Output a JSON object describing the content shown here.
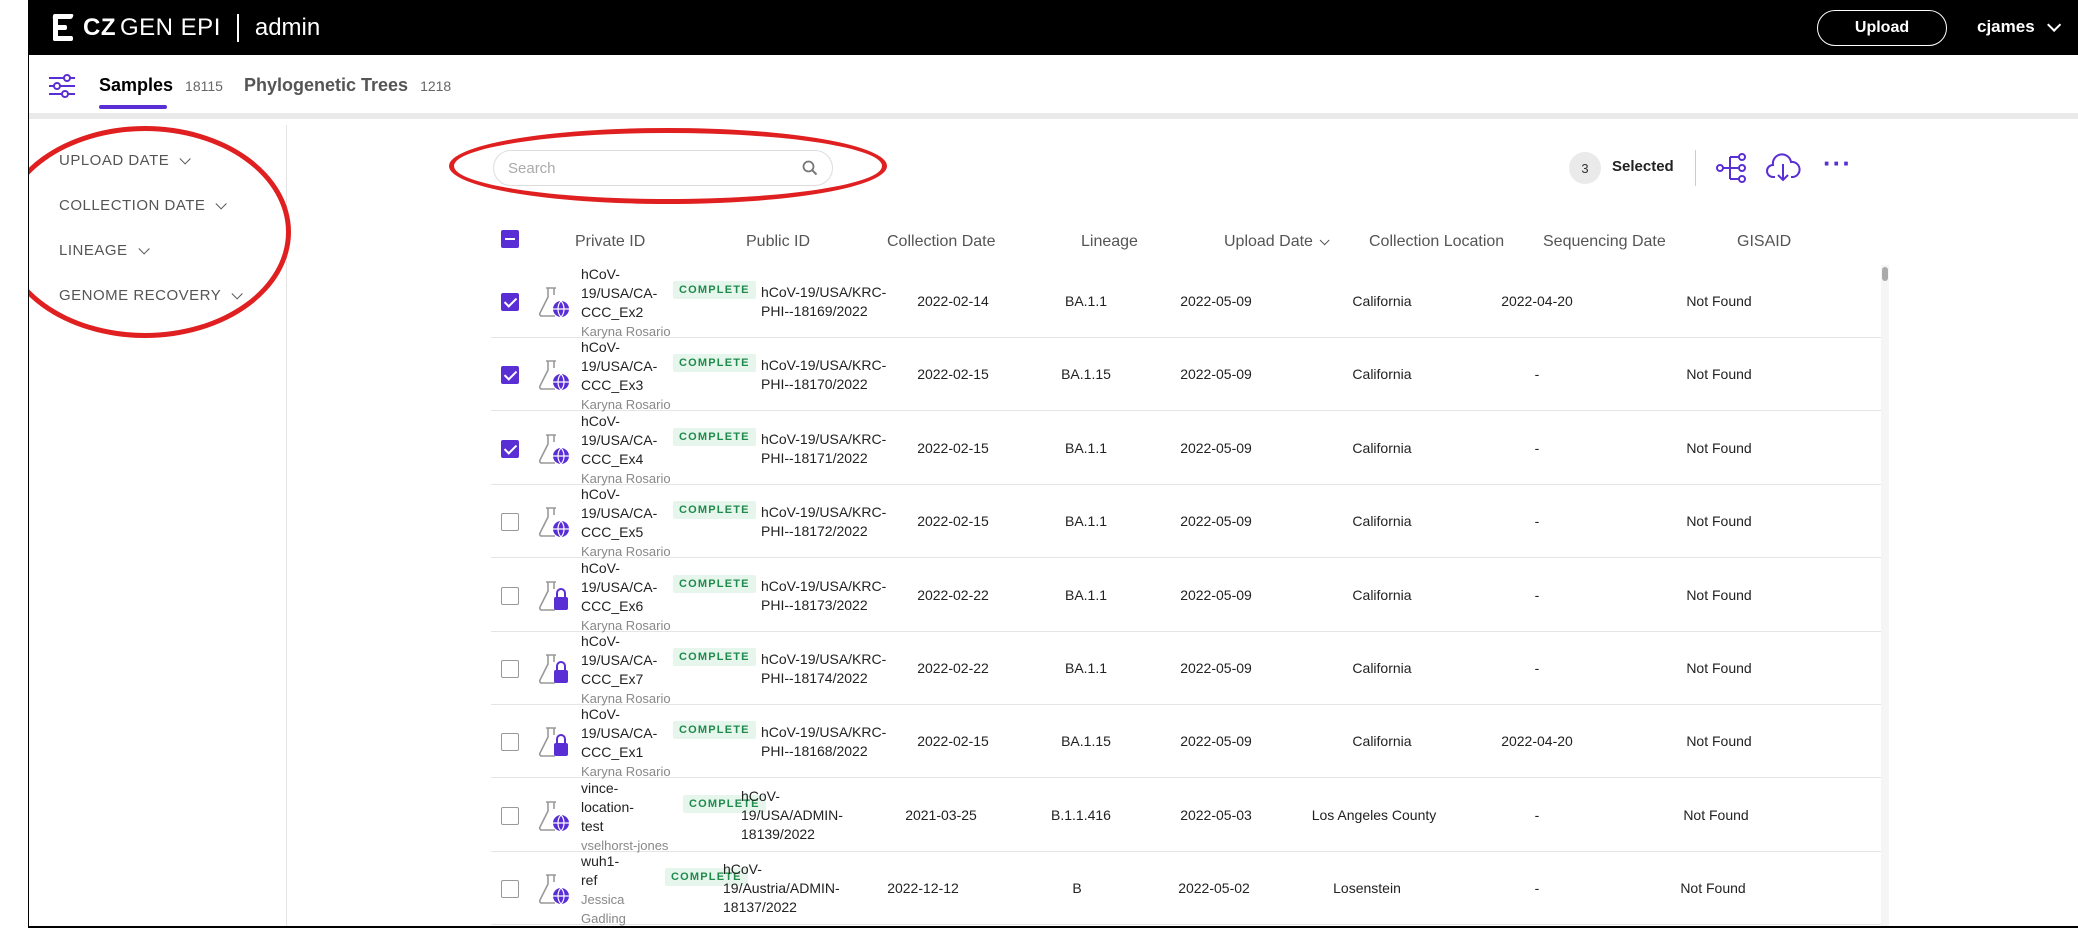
{
  "header": {
    "logo_cz": "CZ",
    "logo_gen_epi": "GEN EPI",
    "admin_label": "admin",
    "upload_label": "Upload",
    "user_name": "cjames"
  },
  "tabs": [
    {
      "label": "Samples",
      "count": "18115",
      "active": true
    },
    {
      "label": "Phylogenetic Trees",
      "count": "1218",
      "active": false
    }
  ],
  "filters": [
    {
      "label": "UPLOAD DATE"
    },
    {
      "label": "COLLECTION DATE"
    },
    {
      "label": "LINEAGE"
    },
    {
      "label": "GENOME RECOVERY"
    }
  ],
  "search": {
    "placeholder": "Search",
    "value": ""
  },
  "toolbar": {
    "selected_count": "3",
    "selected_label": "Selected",
    "tree_icon": "phylo-tree-icon",
    "download_icon": "cloud-download-icon",
    "more_label": "···"
  },
  "table": {
    "columns": [
      "Private ID",
      "Public ID",
      "Collection Date",
      "Lineage",
      "Upload Date",
      "Collection Location",
      "Sequencing Date",
      "GISAID"
    ],
    "sorted_column": "Upload Date",
    "rows": [
      {
        "checked": true,
        "icon": "globe",
        "private_lines": [
          "hCoV-",
          "19/USA/CA-",
          "CCC_Ex2"
        ],
        "uploader": "Karyna Rosario",
        "status": "COMPLETE",
        "public_lines": [
          "hCoV-19/USA/KRC-",
          "PHI--18169/2022"
        ],
        "collection_date": "2022-02-14",
        "lineage": "BA.1.1",
        "upload_date": "2022-05-09",
        "location": "California",
        "sequencing_date": "2022-04-20",
        "gisaid": "Not Found"
      },
      {
        "checked": true,
        "icon": "globe",
        "private_lines": [
          "hCoV-",
          "19/USA/CA-",
          "CCC_Ex3"
        ],
        "uploader": "Karyna Rosario",
        "status": "COMPLETE",
        "public_lines": [
          "hCoV-19/USA/KRC-",
          "PHI--18170/2022"
        ],
        "collection_date": "2022-02-15",
        "lineage": "BA.1.15",
        "upload_date": "2022-05-09",
        "location": "California",
        "sequencing_date": "-",
        "gisaid": "Not Found"
      },
      {
        "checked": true,
        "icon": "globe",
        "private_lines": [
          "hCoV-",
          "19/USA/CA-",
          "CCC_Ex4"
        ],
        "uploader": "Karyna Rosario",
        "status": "COMPLETE",
        "public_lines": [
          "hCoV-19/USA/KRC-",
          "PHI--18171/2022"
        ],
        "collection_date": "2022-02-15",
        "lineage": "BA.1.1",
        "upload_date": "2022-05-09",
        "location": "California",
        "sequencing_date": "-",
        "gisaid": "Not Found"
      },
      {
        "checked": false,
        "icon": "globe",
        "private_lines": [
          "hCoV-",
          "19/USA/CA-",
          "CCC_Ex5"
        ],
        "uploader": "Karyna Rosario",
        "status": "COMPLETE",
        "public_lines": [
          "hCoV-19/USA/KRC-",
          "PHI--18172/2022"
        ],
        "collection_date": "2022-02-15",
        "lineage": "BA.1.1",
        "upload_date": "2022-05-09",
        "location": "California",
        "sequencing_date": "-",
        "gisaid": "Not Found"
      },
      {
        "checked": false,
        "icon": "lock",
        "private_lines": [
          "hCoV-",
          "19/USA/CA-",
          "CCC_Ex6"
        ],
        "uploader": "Karyna Rosario",
        "status": "COMPLETE",
        "public_lines": [
          "hCoV-19/USA/KRC-",
          "PHI--18173/2022"
        ],
        "collection_date": "2022-02-22",
        "lineage": "BA.1.1",
        "upload_date": "2022-05-09",
        "location": "California",
        "sequencing_date": "-",
        "gisaid": "Not Found"
      },
      {
        "checked": false,
        "icon": "lock",
        "private_lines": [
          "hCoV-",
          "19/USA/CA-",
          "CCC_Ex7"
        ],
        "uploader": "Karyna Rosario",
        "status": "COMPLETE",
        "public_lines": [
          "hCoV-19/USA/KRC-",
          "PHI--18174/2022"
        ],
        "collection_date": "2022-02-22",
        "lineage": "BA.1.1",
        "upload_date": "2022-05-09",
        "location": "California",
        "sequencing_date": "-",
        "gisaid": "Not Found"
      },
      {
        "checked": false,
        "icon": "lock",
        "private_lines": [
          "hCoV-",
          "19/USA/CA-",
          "CCC_Ex1"
        ],
        "uploader": "Karyna Rosario",
        "status": "COMPLETE",
        "public_lines": [
          "hCoV-19/USA/KRC-",
          "PHI--18168/2022"
        ],
        "collection_date": "2022-02-15",
        "lineage": "BA.1.15",
        "upload_date": "2022-05-09",
        "location": "California",
        "sequencing_date": "2022-04-20",
        "gisaid": "Not Found"
      },
      {
        "checked": false,
        "icon": "globe",
        "private_lines": [
          "vince-",
          "location-",
          "test"
        ],
        "uploader": "vselhorst-jones",
        "status": "COMPLETE",
        "public_lines": [
          "hCoV-",
          "19/USA/ADMIN-",
          "18139/2022"
        ],
        "collection_date": "2021-03-25",
        "lineage": "B.1.1.416",
        "upload_date": "2022-05-03",
        "location": "Los Angeles County",
        "sequencing_date": "-",
        "gisaid": "Not Found"
      },
      {
        "checked": false,
        "icon": "globe",
        "private_lines": [
          "wuh1-",
          "ref"
        ],
        "uploader": "Jessica Gadling",
        "status": "COMPLETE",
        "public_lines": [
          "hCoV-",
          "19/Austria/ADMIN-",
          "18137/2022"
        ],
        "collection_date": "2022-12-12",
        "lineage": "B",
        "upload_date": "2022-05-02",
        "location": "Losenstein",
        "sequencing_date": "-",
        "gisaid": "Not Found"
      }
    ]
  },
  "colors": {
    "accent": "#5a2ed5",
    "annotation": "#e02020",
    "badge_bg": "#e6f6ec",
    "badge_text": "#1f8a4c"
  }
}
